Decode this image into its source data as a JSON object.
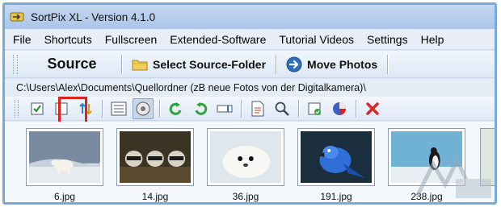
{
  "window": {
    "title": "SortPix XL - Version 4.1.0"
  },
  "menu": {
    "items": [
      "File",
      "Shortcuts",
      "Fullscreen",
      "Extended-Software",
      "Tutorial Videos",
      "Settings",
      "Help"
    ]
  },
  "bigbar": {
    "source_label": "Source",
    "select_folder_label": "Select Source-Folder",
    "move_photos_label": "Move Photos"
  },
  "path": {
    "value": "C:\\Users\\Alex\\Documents\\Quellordner (zB neue Fotos von der Digitalkamera)\\"
  },
  "toolbar": {
    "icons": [
      "select-all-icon",
      "deselect-all-icon",
      "sort-icon",
      "list-view-icon",
      "thumbnail-view-icon",
      "rotate-left-icon",
      "rotate-right-icon",
      "rename-icon",
      "properties-icon",
      "search-icon",
      "edit-icon",
      "slideshow-icon",
      "delete-icon"
    ],
    "highlighted": "deselect-all-icon"
  },
  "gallery": {
    "images": [
      {
        "file": "6.jpg",
        "subject": "polar bear"
      },
      {
        "file": "14.jpg",
        "subject": "raccoons"
      },
      {
        "file": "36.jpg",
        "subject": "seal pup"
      },
      {
        "file": "191.jpg",
        "subject": "blue parrot"
      },
      {
        "file": "238.jpg",
        "subject": "penguin"
      }
    ]
  },
  "colors": {
    "accent": "#7aa8d8",
    "highlight": "#e0201a",
    "delete": "#d62b2b",
    "rotate": "#2fa33a"
  }
}
